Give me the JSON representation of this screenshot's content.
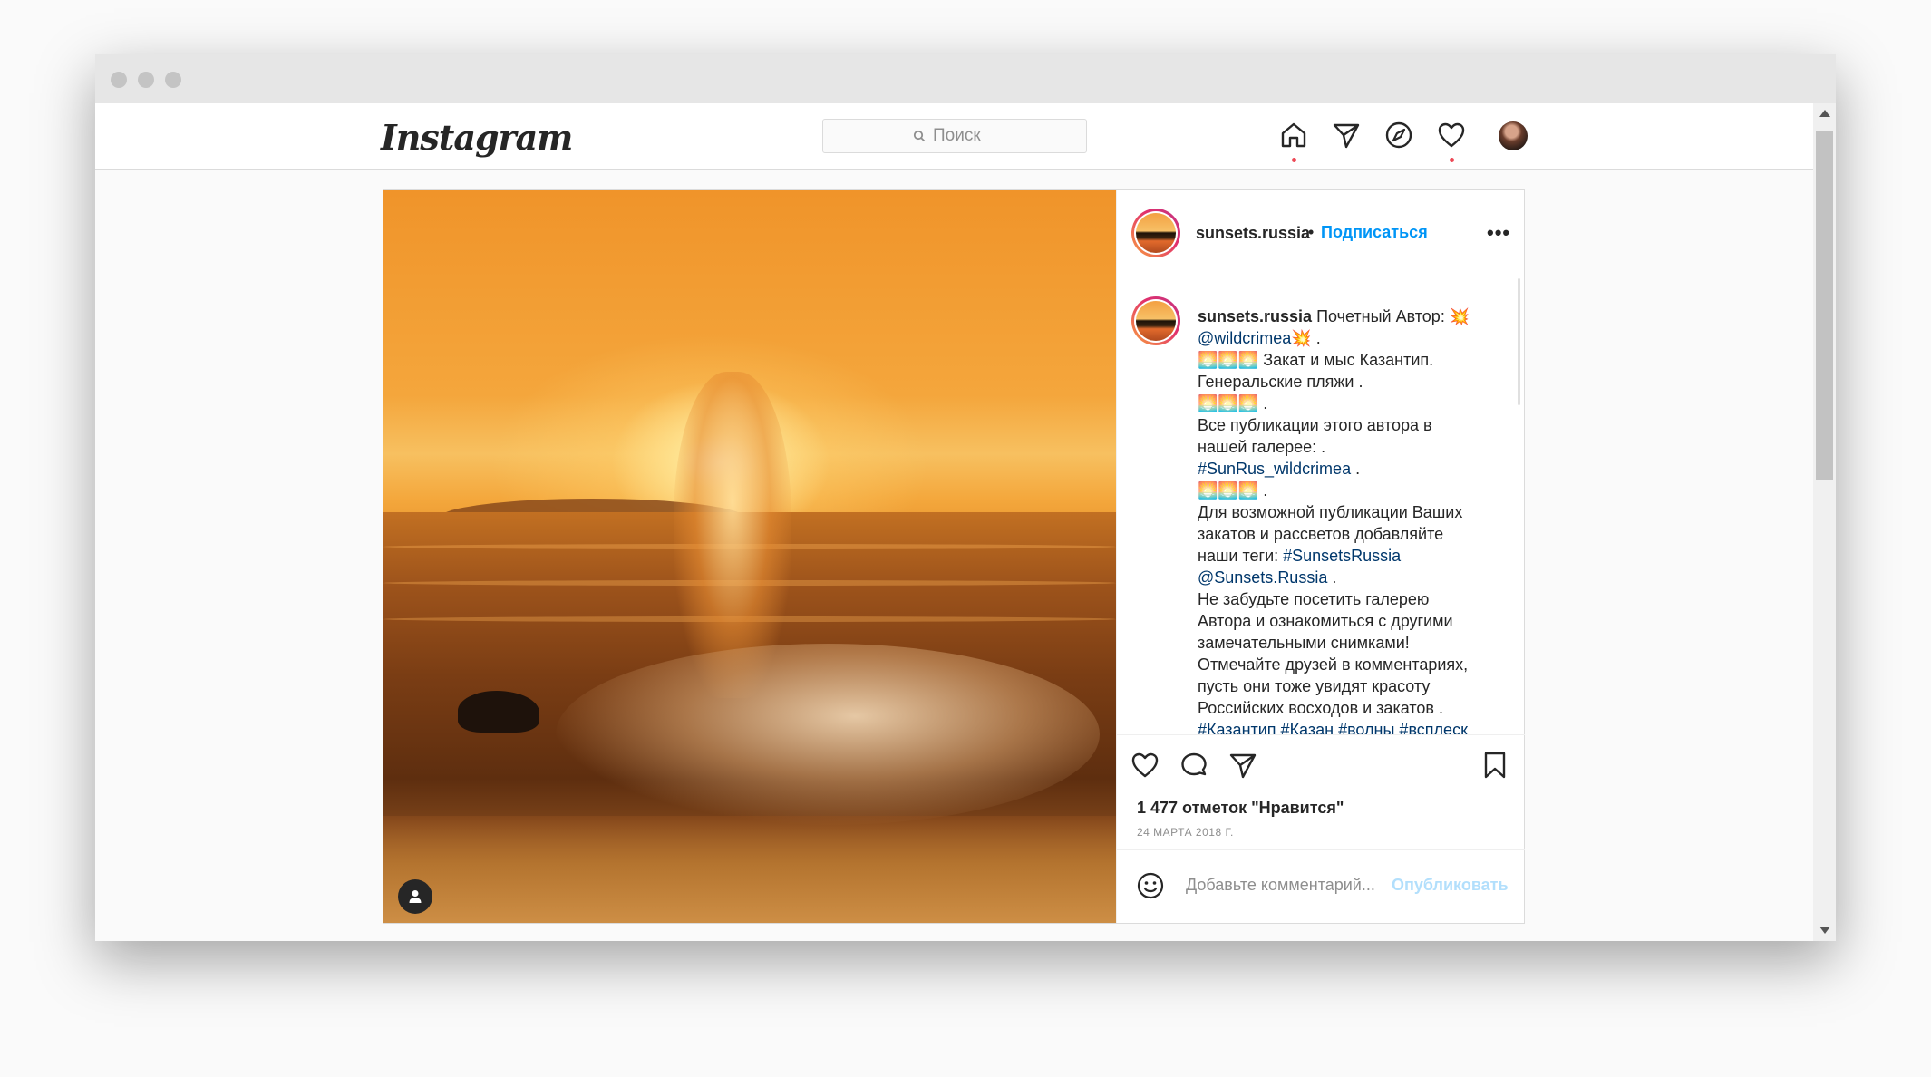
{
  "header": {
    "logo": "Instagram",
    "search_placeholder": "Поиск"
  },
  "post": {
    "author": "sunsets.russia",
    "bullet": "•",
    "follow_label": "Подписаться",
    "more_label": "•••",
    "caption": [
      {
        "parts": [
          {
            "t": "sunsets.russia",
            "c": "u"
          },
          {
            "t": " Почетный Автор: 💥",
            "c": ""
          }
        ]
      },
      {
        "parts": [
          {
            "t": "@wildcrimea",
            "c": "link"
          },
          {
            "t": "💥 .",
            "c": ""
          }
        ]
      },
      {
        "parts": [
          {
            "t": "🌅🌅🌅 Закат и мыс Казантип.",
            "c": ""
          }
        ]
      },
      {
        "parts": [
          {
            "t": "Генеральские пляжи .",
            "c": ""
          }
        ]
      },
      {
        "parts": [
          {
            "t": "🌅🌅🌅 .",
            "c": ""
          }
        ]
      },
      {
        "parts": [
          {
            "t": "Все публикации этого автора в",
            "c": ""
          }
        ]
      },
      {
        "parts": [
          {
            "t": "нашей галерее: .",
            "c": ""
          }
        ]
      },
      {
        "parts": [
          {
            "t": "#SunRus_wildcrimea",
            "c": "link"
          },
          {
            "t": " .",
            "c": ""
          }
        ]
      },
      {
        "parts": [
          {
            "t": "🌅🌅🌅 .",
            "c": ""
          }
        ]
      },
      {
        "parts": [
          {
            "t": "Для возможной публикации Ваших",
            "c": ""
          }
        ]
      },
      {
        "parts": [
          {
            "t": "закатов и рассветов добавляйте",
            "c": ""
          }
        ]
      },
      {
        "parts": [
          {
            "t": "наши теги: ",
            "c": ""
          },
          {
            "t": "#SunsetsRussia",
            "c": "link"
          }
        ]
      },
      {
        "parts": [
          {
            "t": "@Sunsets.Russia",
            "c": "link"
          },
          {
            "t": " .",
            "c": ""
          }
        ]
      },
      {
        "parts": [
          {
            "t": "Не забудьте посетить галерею",
            "c": ""
          }
        ]
      },
      {
        "parts": [
          {
            "t": "Автора и ознакомиться с другими",
            "c": ""
          }
        ]
      },
      {
        "parts": [
          {
            "t": "замечательными снимками!",
            "c": ""
          }
        ]
      },
      {
        "parts": [
          {
            "t": "Отмечайте друзей в комментариях,",
            "c": ""
          }
        ]
      },
      {
        "parts": [
          {
            "t": "пусть они тоже увидят красоту",
            "c": ""
          }
        ]
      },
      {
        "parts": [
          {
            "t": "Российских восходов и закатов .",
            "c": ""
          }
        ]
      },
      {
        "parts": [
          {
            "t": "#Казантип #Казан #волны #всплеск",
            "c": "link"
          }
        ]
      }
    ],
    "likes": "1 477 отметок \"Нравится\"",
    "date": "24 МАРТА 2018 Г.",
    "comment_placeholder": "Добавьте комментарий...",
    "publish_label": "Опубликовать"
  },
  "icons": {
    "nav": [
      "home-icon",
      "direct-icon",
      "explore-icon",
      "activity-heart-icon",
      "profile-avatar"
    ],
    "actions": [
      "like-heart-icon",
      "comment-icon",
      "share-icon",
      "bookmark-icon"
    ]
  },
  "colors": {
    "link": "#00376b",
    "follow": "#0095f6",
    "publish_disabled": "#b2dffc",
    "notification_dot": "#ed4956"
  }
}
